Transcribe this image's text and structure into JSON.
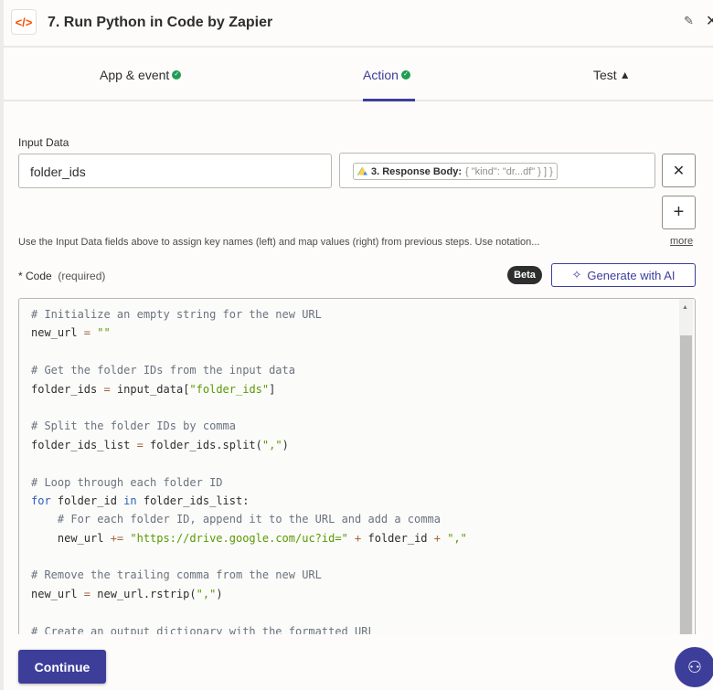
{
  "header": {
    "title": "7. Run Python in Code by Zapier",
    "icon": "code-icon"
  },
  "tabs": [
    {
      "label": "App & event",
      "status": "complete"
    },
    {
      "label": "Action",
      "status": "complete"
    },
    {
      "label": "Test",
      "status": "warning"
    }
  ],
  "input_data": {
    "label": "Input Data",
    "key_value": "folder_ids",
    "mapped_step": "3. Response Body:",
    "mapped_preview": "{    \"kind\": \"dr...df\"     }  ] }",
    "help_text": "Use the Input Data fields above to assign key names (left) and map values (right) from previous steps. Use notation...",
    "more_label": "more"
  },
  "code": {
    "label": "* Code",
    "required": "(required)",
    "beta": "Beta",
    "generate_label": "Generate with AI",
    "lines": [
      [
        [
          "cm",
          "# Initialize an empty string for the new URL"
        ]
      ],
      [
        [
          "",
          "new_url "
        ],
        [
          "op",
          "="
        ],
        [
          "st",
          " \"\""
        ]
      ],
      [],
      [
        [
          "cm",
          "# Get the folder IDs from the input data"
        ]
      ],
      [
        [
          "",
          "folder_ids "
        ],
        [
          "op",
          "="
        ],
        [
          "",
          " input_data["
        ],
        [
          "st",
          "\"folder_ids\""
        ],
        [
          "",
          "]"
        ]
      ],
      [],
      [
        [
          "cm",
          "# Split the folder IDs by comma"
        ]
      ],
      [
        [
          "",
          "folder_ids_list "
        ],
        [
          "op",
          "="
        ],
        [
          "",
          " folder_ids.split("
        ],
        [
          "st",
          "\",\""
        ],
        [
          "",
          ")"
        ]
      ],
      [],
      [
        [
          "cm",
          "# Loop through each folder ID"
        ]
      ],
      [
        [
          "kw",
          "for"
        ],
        [
          "",
          " folder_id "
        ],
        [
          "kw",
          "in"
        ],
        [
          "",
          " folder_ids_list:"
        ]
      ],
      [
        [
          "",
          "    "
        ],
        [
          "cm",
          "# For each folder ID, append it to the URL and add a comma"
        ]
      ],
      [
        [
          "",
          "    new_url "
        ],
        [
          "op",
          "+="
        ],
        [
          "st",
          " \"https://drive.google.com/uc?id=\""
        ],
        [
          "",
          " "
        ],
        [
          "op",
          "+"
        ],
        [
          "",
          " folder_id "
        ],
        [
          "op",
          "+"
        ],
        [
          "st",
          " \",\""
        ]
      ],
      [],
      [
        [
          "cm",
          "# Remove the trailing comma from the new URL"
        ]
      ],
      [
        [
          "",
          "new_url "
        ],
        [
          "op",
          "="
        ],
        [
          "",
          " new_url.rstrip("
        ],
        [
          "st",
          "\",\""
        ],
        [
          "",
          ")"
        ]
      ],
      [],
      [
        [
          "cm",
          "# Create an output dictionary with the formatted URL"
        ]
      ]
    ]
  },
  "footer": {
    "continue_label": "Continue"
  },
  "colors": {
    "accent": "#3d3e9a",
    "success": "#1f9d55",
    "brand": "#ff4f00"
  }
}
